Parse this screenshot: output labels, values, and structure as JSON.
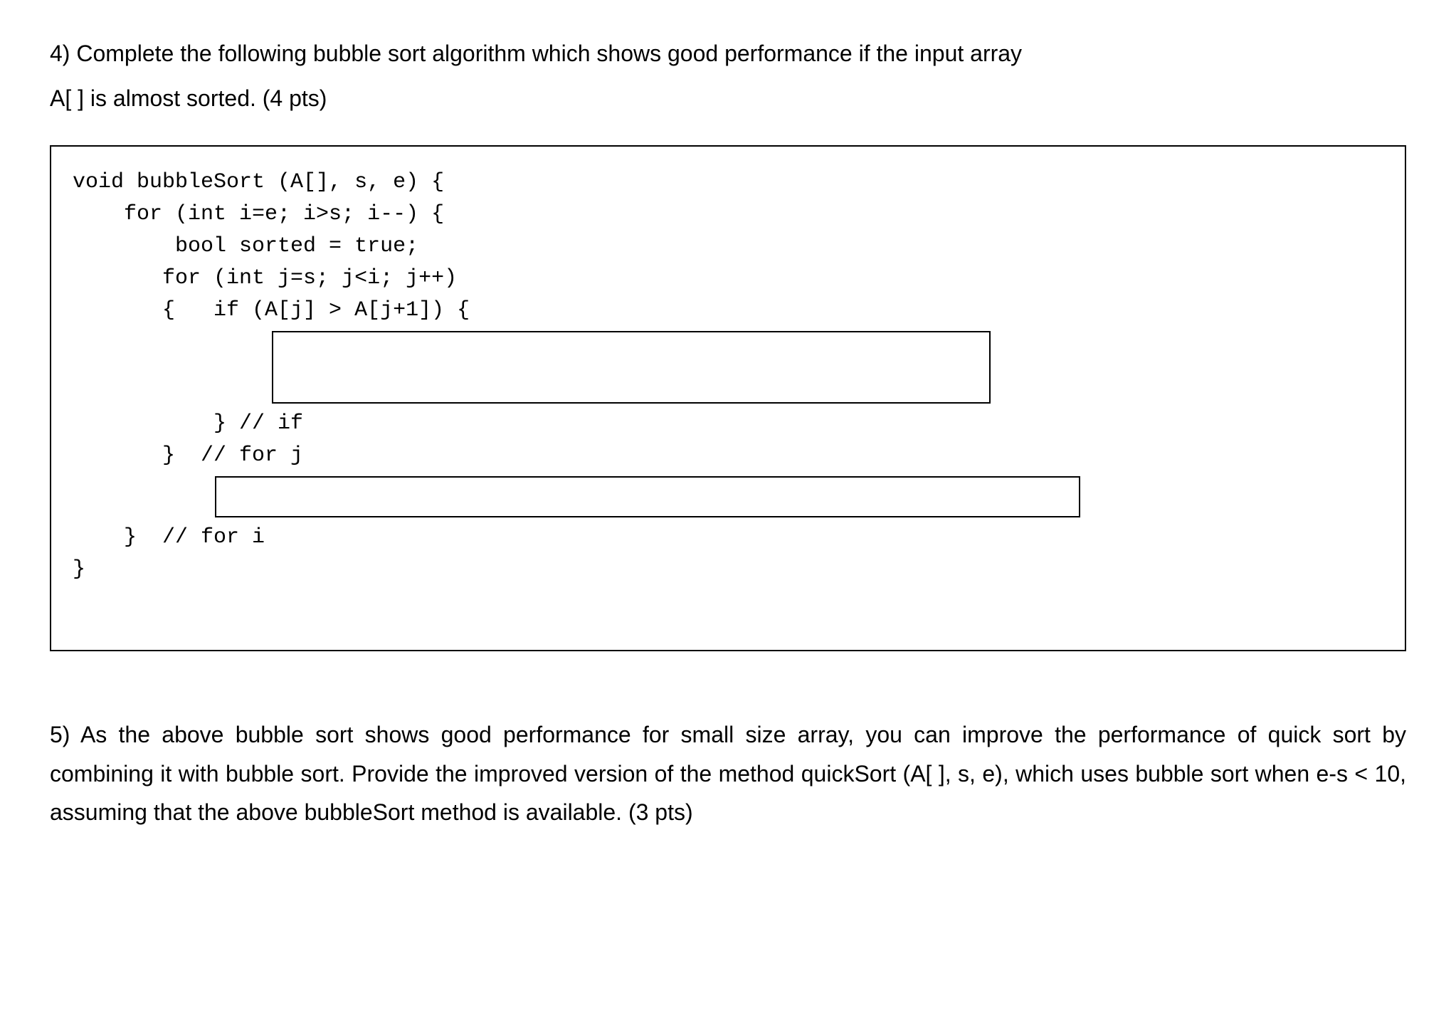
{
  "q4": {
    "line1": "4) Complete the following bubble sort algorithm which shows good performance if the input array",
    "line2": "A[ ] is almost sorted. (4 pts)"
  },
  "code": {
    "l1": "void bubbleSort (A[], s, e) {",
    "l2": "",
    "l3": "    for (int i=e; i>s; i--) {",
    "l4": "        bool sorted = true;",
    "l5": "       for (int j=s; j<i; j++)",
    "l6": "       {   if (A[j] > A[j+1]) {",
    "l7": "           } // if",
    "l8": "       }  // for j",
    "l9": "    }  // for i",
    "l10": "}"
  },
  "q5": {
    "text": "5) As the above bubble sort shows good performance for small size array, you can improve the performance of quick sort by combining it with bubble sort.  Provide the improved version of the method quickSort (A[ ], s, e), which uses bubble sort when e-s < 10, assuming that the above bubbleSort method is available. (3 pts)"
  }
}
